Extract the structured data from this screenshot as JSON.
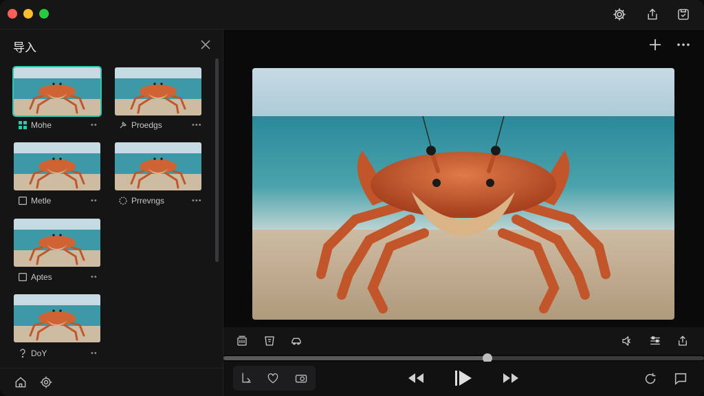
{
  "colors": {
    "accent": "#2fc6b2",
    "close": "#fe5f57",
    "minimize": "#febc2e",
    "maximize": "#28c840"
  },
  "sidebar": {
    "title": "导入",
    "items": [
      {
        "label": "Mohe",
        "icon": "grid-icon",
        "more": "••",
        "selected": true
      },
      {
        "label": "Proedgs",
        "icon": "pin-icon",
        "more": "•••",
        "selected": false
      },
      {
        "label": "Metle",
        "icon": "checkbox-icon",
        "more": "••",
        "selected": false
      },
      {
        "label": "Prrevngs",
        "icon": "badge-icon",
        "more": "•••",
        "selected": false
      },
      {
        "label": "Aptes",
        "icon": "checkbox-icon",
        "more": "••",
        "selected": false
      },
      {
        "label": "DoY",
        "icon": "question-icon",
        "more": "••",
        "selected": false
      }
    ]
  },
  "player": {
    "progress": 0.55
  }
}
